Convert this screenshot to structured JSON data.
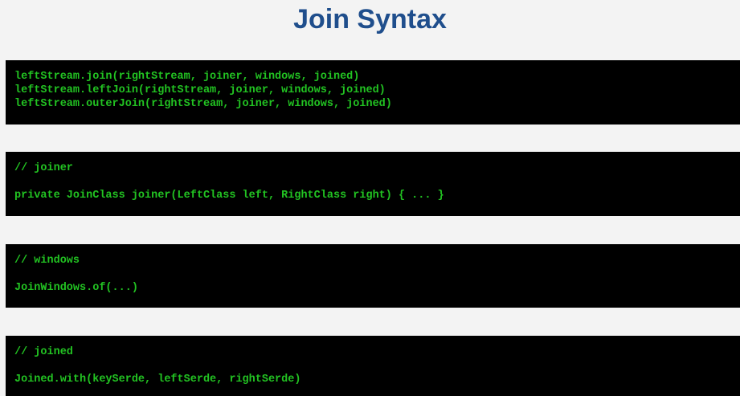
{
  "title": "Join Syntax",
  "blocks": [
    {
      "lines": [
        "leftStream.join(rightStream, joiner, windows, joined)",
        "leftStream.leftJoin(rightStream, joiner, windows, joined)",
        "leftStream.outerJoin(rightStream, joiner, windows, joined)"
      ]
    },
    {
      "comment": "// joiner",
      "code": "private JoinClass joiner(LeftClass left, RightClass right) { ... }"
    },
    {
      "comment": "// windows",
      "code": "JoinWindows.of(...)"
    },
    {
      "comment": "// joined",
      "code": "Joined.with(keySerde, leftSerde, rightSerde)"
    }
  ],
  "colors": {
    "title": "#1f4e8c",
    "code_text": "#22c322",
    "code_background": "#000000",
    "page_background": "#f3f3f3"
  }
}
